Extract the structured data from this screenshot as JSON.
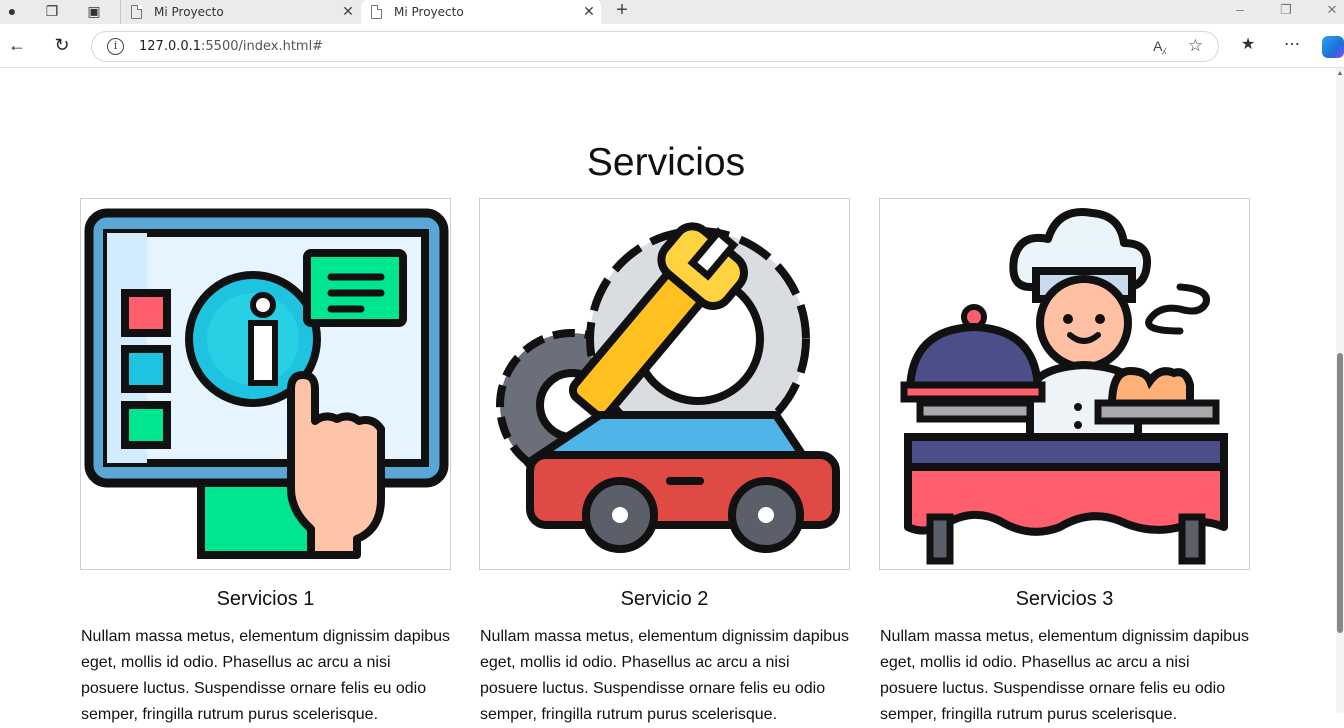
{
  "browser": {
    "tabs": [
      {
        "title": "Mi Proyecto",
        "active": false
      },
      {
        "title": "Mi Proyecto",
        "active": true
      }
    ],
    "url_host": "127.0.0.1",
    "url_rest": ":5500/index.html#"
  },
  "section": {
    "title": "Servicios",
    "cards": [
      {
        "heading": "Servicios 1",
        "icon": "info-touchscreen-icon",
        "text": "Nullam massa metus, elementum dignissim dapibus eget, mollis id odio. Phasellus ac arcu a nisi posuere luctus. Suspendisse ornare felis eu odio semper, fringilla rutrum purus scelerisque."
      },
      {
        "heading": "Servicio 2",
        "icon": "car-repair-icon",
        "text": "Nullam massa metus, elementum dignissim dapibus eget, mollis id odio. Phasellus ac arcu a nisi posuere luctus. Suspendisse ornare felis eu odio semper, fringilla rutrum purus scelerisque."
      },
      {
        "heading": "Servicios 3",
        "icon": "chef-catering-icon",
        "text": "Nullam massa metus, elementum dignissim dapibus eget, mollis id odio. Phasellus ac arcu a nisi posuere luctus. Suspendisse ornare felis eu odio semper, fringilla rutrum purus scelerisque."
      }
    ]
  },
  "colors": {
    "accent_green": "#00e58f",
    "accent_red": "#ff5f6d",
    "accent_yellow": "#ffd23f",
    "outline": "#111111"
  }
}
